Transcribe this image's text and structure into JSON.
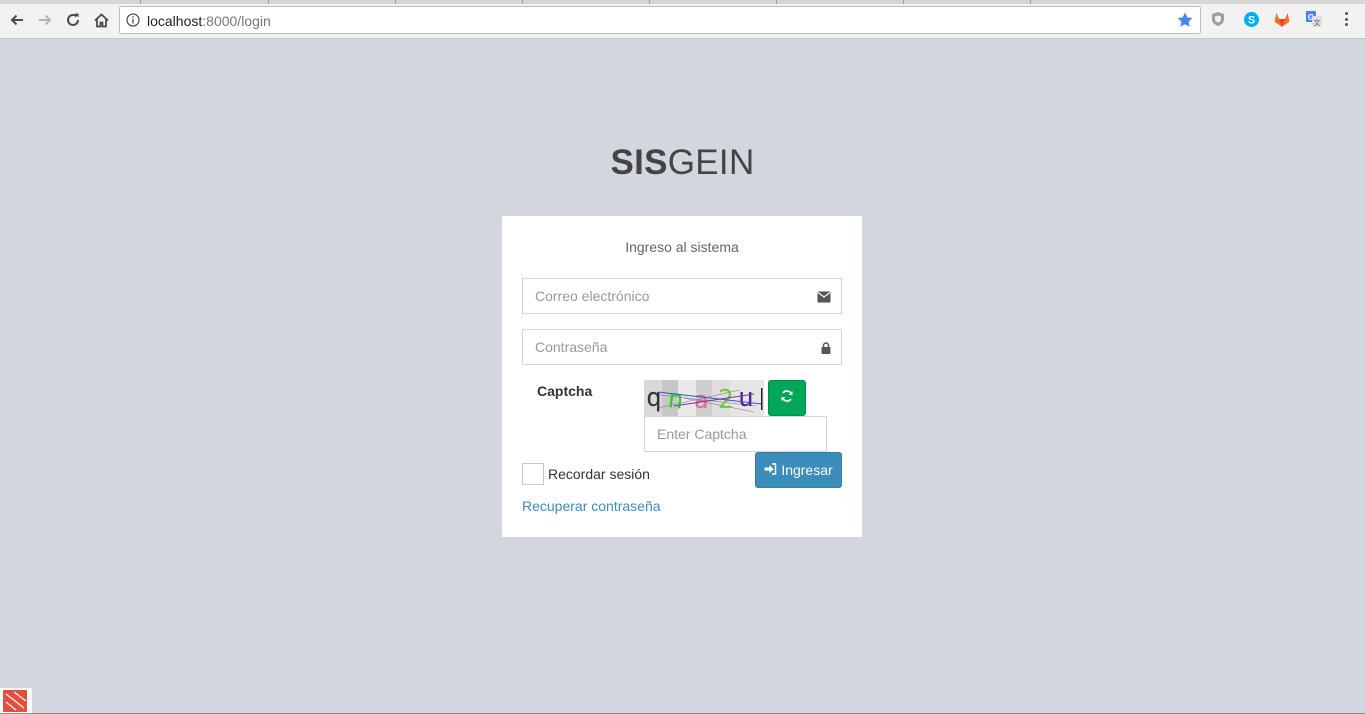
{
  "browser": {
    "url_host": "localhost",
    "url_rest": ":8000/login",
    "toolbar_icons": [
      "back-arrow-icon",
      "forward-arrow-icon",
      "reload-icon",
      "home-icon",
      "info-icon",
      "bookmark-star-icon"
    ],
    "extension_icons": [
      "shield-extension-icon",
      "skype-extension-icon",
      "gitlab-extension-icon",
      "translate-extension-icon",
      "kebab-menu-icon"
    ]
  },
  "page": {
    "logo_bold": "SIS",
    "logo_regular": "GEIN",
    "background_color": "#d2d6de"
  },
  "login": {
    "box_message": "Ingreso al sistema",
    "email": {
      "placeholder": "Correo electrónico",
      "value": "",
      "icon": "envelope-icon"
    },
    "password": {
      "placeholder": "Contraseña",
      "value": "",
      "icon": "lock-icon"
    },
    "captcha": {
      "label": "Captcha",
      "image_text": "qna2u",
      "refresh_icon": "refresh-icon",
      "input_placeholder": "Enter Captcha",
      "input_value": ""
    },
    "remember_label": "Recordar sesión",
    "remember_checked": false,
    "submit_label": "Ingresar",
    "submit_icon": "sign-in-icon",
    "forgot_link": "Recuperar contraseña"
  },
  "colors": {
    "primary": "#3c8dbc",
    "success": "#00a65a",
    "star": "#4285f4"
  }
}
